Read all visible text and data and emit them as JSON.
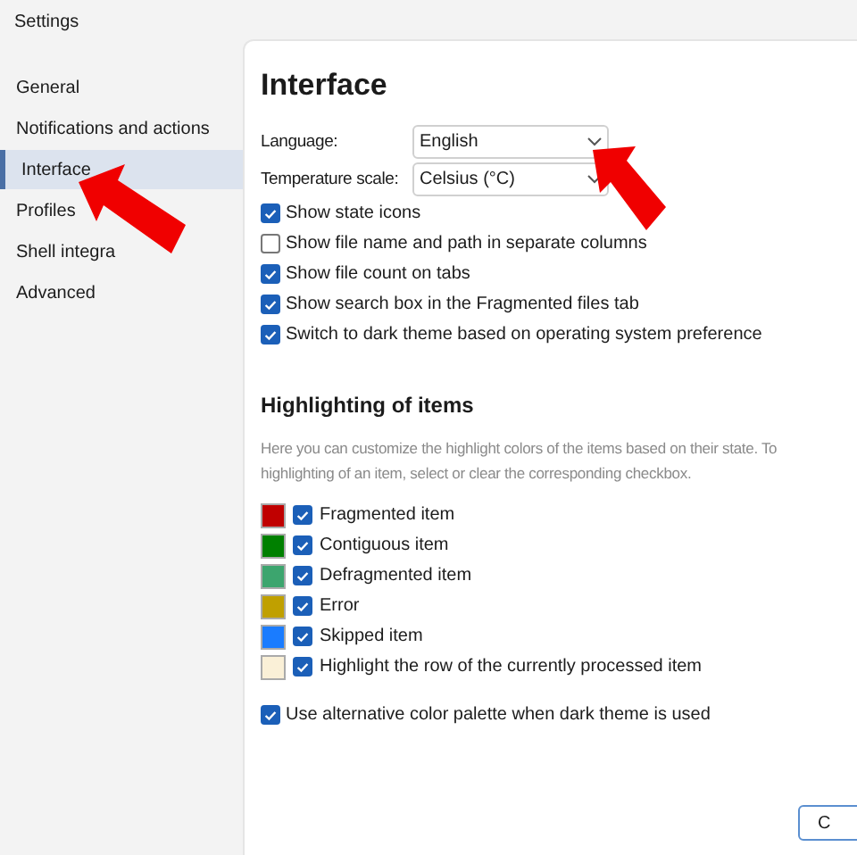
{
  "window": {
    "title": "Settings"
  },
  "sidebar": {
    "items": [
      {
        "label": "General",
        "selected": false
      },
      {
        "label": "Notifications and actions",
        "selected": false
      },
      {
        "label": "Interface",
        "selected": true
      },
      {
        "label": "Profiles",
        "selected": false
      },
      {
        "label": "Shell integra",
        "selected": false
      },
      {
        "label": "Advanced",
        "selected": false
      }
    ]
  },
  "page": {
    "title": "Interface",
    "fields": [
      {
        "label": "Language:",
        "value": "English"
      },
      {
        "label": "Temperature scale:",
        "value": "Celsius (°C)"
      }
    ],
    "options": [
      {
        "label": "Show state icons",
        "checked": true
      },
      {
        "label": "Show file name and path in separate columns",
        "checked": false
      },
      {
        "label": "Show file count on tabs",
        "checked": true
      },
      {
        "label": "Show search box in the Fragmented files tab",
        "checked": true
      },
      {
        "label": "Switch to dark theme based on operating system preference",
        "checked": true
      }
    ],
    "highlighting": {
      "title": "Highlighting of items",
      "description_lines": [
        "Here you can customize the highlight colors of the items based on their state. To",
        "highlighting of an item, select or clear the corresponding checkbox."
      ],
      "items": [
        {
          "label": "Fragmented item",
          "color": "#c00000",
          "checked": true
        },
        {
          "label": "Contiguous item",
          "color": "#008000",
          "checked": true
        },
        {
          "label": "Defragmented item",
          "color": "#3ca56e",
          "checked": true
        },
        {
          "label": "Error",
          "color": "#c0a000",
          "checked": true
        },
        {
          "label": "Skipped item",
          "color": "#1a7cff",
          "checked": true
        },
        {
          "label": "Highlight the row of the currently processed item",
          "color": "#faf0d7",
          "checked": true
        }
      ],
      "alt_palette": {
        "label": "Use alternative color palette when dark theme is used",
        "checked": true
      }
    },
    "button": {
      "label": "C"
    }
  }
}
